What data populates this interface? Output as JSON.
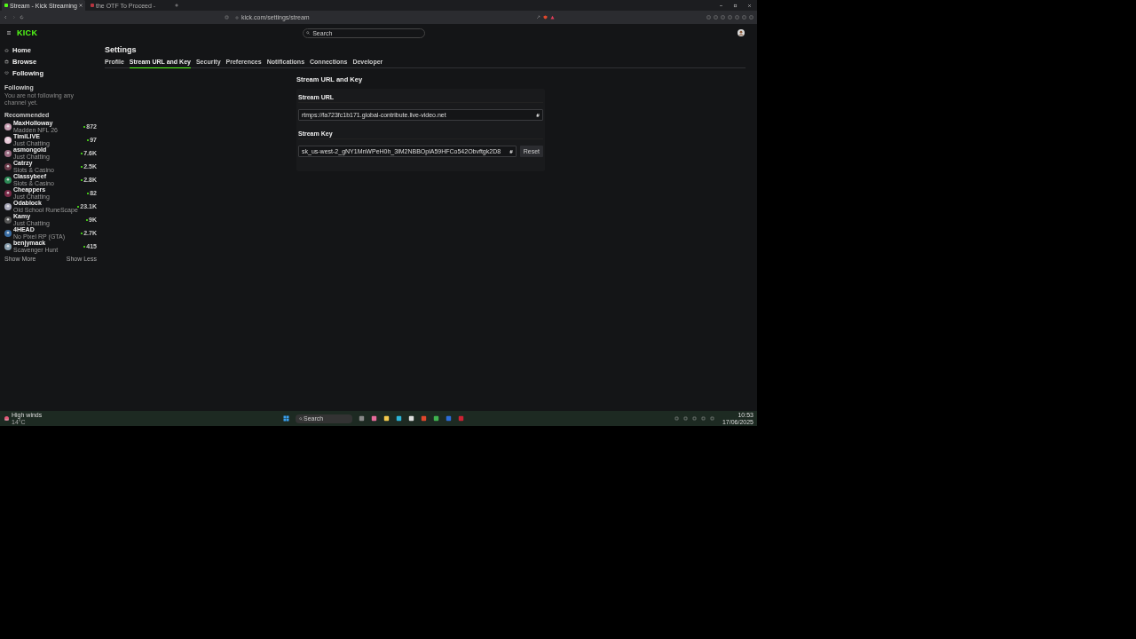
{
  "browser": {
    "tabs": [
      {
        "title": "Stream - Kick Streaming",
        "selected": true
      },
      {
        "title": "the OTF To Proceed -",
        "selected": false
      }
    ],
    "url": "kick.com/settings/stream"
  },
  "header": {
    "logo": "KICK",
    "search": {
      "placeholder": "Search"
    }
  },
  "sidebar": {
    "nav": [
      {
        "label": "Home",
        "kind": "home"
      },
      {
        "label": "Browse",
        "kind": "browse"
      },
      {
        "label": "Following",
        "kind": "following"
      }
    ],
    "following_title": "Following",
    "following_empty": "You are not following any channel yet.",
    "recommended_title": "Recommended",
    "channels": [
      {
        "name": "MaxHolloway",
        "category": "Madden NFL 26",
        "viewers": "872"
      },
      {
        "name": "TimiLIVE",
        "category": "Just Chatting",
        "viewers": "97"
      },
      {
        "name": "asmongold",
        "category": "Just Chatting",
        "viewers": "7.6K"
      },
      {
        "name": "Catrzy",
        "category": "Slots & Casino",
        "viewers": "2.5K"
      },
      {
        "name": "Classybeef",
        "category": "Slots & Casino",
        "viewers": "2.8K"
      },
      {
        "name": "Cheappers",
        "category": "Just Chatting",
        "viewers": "82"
      },
      {
        "name": "Odablock",
        "category": "Old School RuneScape",
        "viewers": "23.1K"
      },
      {
        "name": "Kamy",
        "category": "Just Chatting",
        "viewers": "9K"
      },
      {
        "name": "4HEAD",
        "category": "No Pixel RP (GTA)",
        "viewers": "2.7K"
      },
      {
        "name": "benjymack",
        "category": "Scavenger Hunt",
        "viewers": "415"
      }
    ],
    "show_more": "Show More",
    "show_less": "Show Less"
  },
  "settings": {
    "title": "Settings",
    "tabs": [
      {
        "label": "Profile",
        "selected": false
      },
      {
        "label": "Stream URL and Key",
        "selected": true
      },
      {
        "label": "Security",
        "selected": false
      },
      {
        "label": "Preferences",
        "selected": false
      },
      {
        "label": "Notifications",
        "selected": false
      },
      {
        "label": "Connections",
        "selected": false
      },
      {
        "label": "Developer",
        "selected": false
      }
    ],
    "section_title": "Stream URL and Key",
    "fields": [
      {
        "label": "Stream URL",
        "value": "rtmps://fa723fc1b171.global-contribute.live-video.net"
      },
      {
        "label": "Stream Key",
        "value": "sk_us-west-2_gNY1MnWPeH0h_3lM2NBBOplA59HFCo542Obvftgk2D8",
        "action": "Reset"
      }
    ]
  },
  "taskbar": {
    "weather": "High winds",
    "weather_detail": "14°C",
    "search": {
      "placeholder": "Search"
    },
    "time": "10:53",
    "date": "17/06/2025"
  }
}
